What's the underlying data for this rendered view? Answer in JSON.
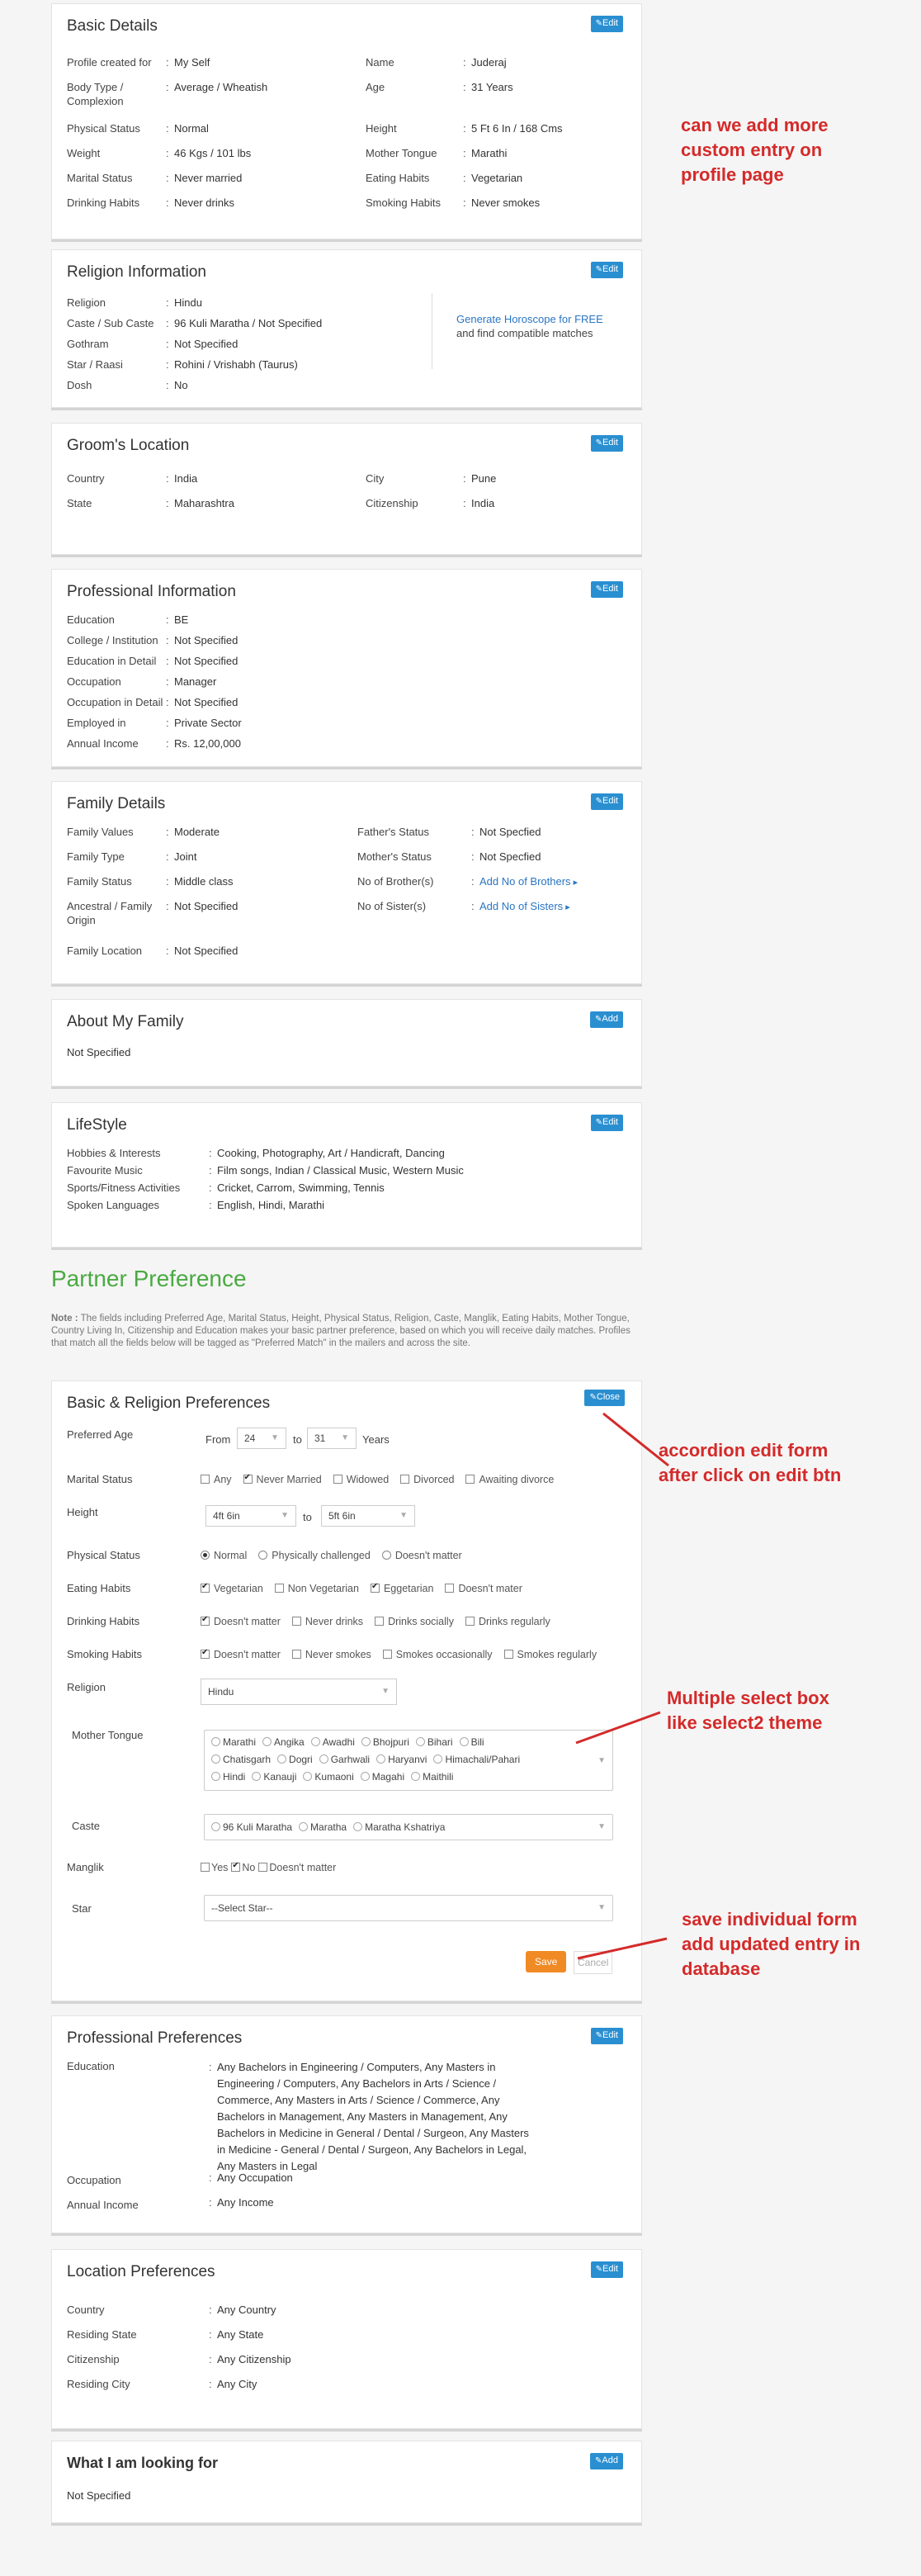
{
  "basic": {
    "title": "Basic Details",
    "edit": "Edit",
    "left": [
      [
        "Profile created for",
        "My Self"
      ],
      [
        "Body Type / Complexion",
        "Average / Wheatish"
      ],
      [
        "Physical Status",
        "Normal"
      ],
      [
        "Weight",
        "46 Kgs / 101 lbs"
      ],
      [
        "Marital Status",
        "Never married"
      ],
      [
        "Drinking Habits",
        "Never drinks"
      ]
    ],
    "right": [
      [
        "Name",
        "Juderaj"
      ],
      [
        "Age",
        "31 Years"
      ],
      [
        "Height",
        "5 Ft 6 In / 168 Cms"
      ],
      [
        "Mother Tongue",
        "Marathi"
      ],
      [
        "Eating Habits",
        "Vegetarian"
      ],
      [
        "Smoking Habits",
        "Never smokes"
      ]
    ]
  },
  "religion": {
    "title": "Religion Information",
    "edit": "Edit",
    "rows": [
      [
        "Religion",
        "Hindu"
      ],
      [
        "Caste / Sub Caste",
        "96 Kuli Maratha / Not Specified"
      ],
      [
        "Gothram",
        "Not Specified"
      ],
      [
        "Star / Raasi",
        "Rohini / Vrishabh (Taurus)"
      ],
      [
        "Dosh",
        "No"
      ]
    ],
    "horo_link": "Generate Horoscope for FREE",
    "horo_text": "and find compatible matches"
  },
  "location": {
    "title": "Groom's Location",
    "edit": "Edit",
    "rows": [
      [
        "Country",
        "India",
        "City",
        "Pune"
      ],
      [
        "State",
        "Maharashtra",
        "Citizenship",
        "India"
      ]
    ]
  },
  "professional": {
    "title": "Professional Information",
    "edit": "Edit",
    "rows": [
      [
        "Education",
        "BE"
      ],
      [
        "College / Institution",
        "Not Specified"
      ],
      [
        "Education in Detail",
        "Not Specified"
      ],
      [
        "Occupation",
        "Manager"
      ],
      [
        "Occupation in Detail",
        "Not Specified"
      ],
      [
        "Employed in",
        "Private Sector"
      ],
      [
        "Annual Income",
        "Rs. 12,00,000"
      ]
    ]
  },
  "family": {
    "title": "Family Details",
    "edit": "Edit",
    "left": [
      [
        "Family Values",
        "Moderate"
      ],
      [
        "Family Type",
        "Joint"
      ],
      [
        "Family Status",
        "Middle class"
      ],
      [
        "Ancestral / Family Origin",
        "Not Specified"
      ],
      [
        "Family Location",
        "Not Specified"
      ]
    ],
    "right": [
      [
        "Father's Status",
        "Not Specfied"
      ],
      [
        "Mother's Status",
        "Not Specfied"
      ],
      [
        "No of Brother(s)",
        "Add No of Brothers"
      ],
      [
        "No of Sister(s)",
        "Add No of Sisters"
      ]
    ]
  },
  "about_family": {
    "title": "About My Family",
    "add": "Add",
    "text": "Not Specified"
  },
  "lifestyle": {
    "title": "LifeStyle",
    "edit": "Edit",
    "rows": [
      [
        "Hobbies & Interests",
        "Cooking, Photography, Art / Handicraft, Dancing"
      ],
      [
        "Favourite Music",
        "Film songs, Indian / Classical Music, Western Music"
      ],
      [
        "Sports/Fitness Activities",
        "Cricket, Carrom, Swimming, Tennis"
      ],
      [
        "Spoken Languages",
        "English, Hindi, Marathi"
      ]
    ]
  },
  "partner": {
    "title": "Partner Preference",
    "note_bold": "Note :",
    "note": " The fields including Preferred Age, Marital Status, Height, Physical Status, Religion, Caste, Manglik, Eating Habits, Mother Tongue, Country Living In, Citizenship and Education makes your basic partner preference, based on which you will receive daily matches. Profiles that match all the fields below will be tagged as \"Preferred Match\" in the mailers and across the site."
  },
  "basic_pref": {
    "title": "Basic & Religion Preferences",
    "close": "Close",
    "age": {
      "label": "Preferred Age",
      "from": "From",
      "from_val": "24",
      "to": "to",
      "to_val": "31",
      "unit": "Years"
    },
    "marital": {
      "label": "Marital Status",
      "opts": [
        [
          "Any",
          false
        ],
        [
          "Never Married",
          true
        ],
        [
          "Widowed",
          false
        ],
        [
          "Divorced",
          false
        ],
        [
          "Awaiting divorce",
          false
        ]
      ]
    },
    "height": {
      "label": "Height",
      "from": "4ft 6in",
      "to": "to",
      "to_val": "5ft 6in"
    },
    "physical": {
      "label": "Physical Status",
      "opts": [
        [
          "Normal",
          true
        ],
        [
          "Physically challenged",
          false
        ],
        [
          "Doesn't matter",
          false
        ]
      ]
    },
    "eating": {
      "label": "Eating Habits",
      "opts": [
        [
          "Vegetarian",
          true
        ],
        [
          "Non Vegetarian",
          false
        ],
        [
          "Eggetarian",
          true
        ],
        [
          "Doesn't mater",
          false
        ]
      ]
    },
    "drinking": {
      "label": "Drinking Habits",
      "opts": [
        [
          "Doesn't matter",
          true
        ],
        [
          "Never drinks",
          false
        ],
        [
          "Drinks socially",
          false
        ],
        [
          "Drinks regularly",
          false
        ]
      ]
    },
    "smoking": {
      "label": "Smoking Habits",
      "opts": [
        [
          "Doesn't matter",
          true
        ],
        [
          "Never smokes",
          false
        ],
        [
          "Smokes occasionally",
          false
        ],
        [
          "Smokes regularly",
          false
        ]
      ]
    },
    "religion": {
      "label": "Religion",
      "value": "Hindu"
    },
    "mother_tongue": {
      "label": "Mother Tongue",
      "line1": [
        "Marathi",
        "Angika",
        "Awadhi",
        "Bhojpuri",
        "Bihari",
        "Bili"
      ],
      "line2": [
        "Chatisgarh",
        "Dogri",
        "Garhwali",
        "Haryanvi",
        "Himachali/Pahari"
      ],
      "line3": [
        "Hindi",
        "Kanauji",
        "Kumaoni",
        "Magahi",
        "Maithili"
      ]
    },
    "caste": {
      "label": "Caste",
      "values": [
        "96 Kuli Maratha",
        "Maratha",
        "Maratha Kshatriya"
      ]
    },
    "manglik": {
      "label": "Manglik",
      "opts": [
        [
          "Yes",
          false
        ],
        [
          "No",
          true
        ],
        [
          "Doesn't matter",
          false
        ]
      ]
    },
    "star": {
      "label": "Star",
      "value": "--Select Star--"
    },
    "save": "Save",
    "cancel": "Cancel"
  },
  "prof_pref": {
    "title": "Professional Preferences",
    "edit": "Edit",
    "education_label": "Education",
    "education": "Any Bachelors in Engineering / Computers, Any Masters in Engineering / Computers, Any Bachelors in Arts / Science / Commerce, Any Masters in Arts / Science / Commerce, Any Bachelors in Management, Any Masters in Management, Any Bachelors in Medicine in General / Dental / Surgeon, Any Masters in Medicine - General / Dental / Surgeon, Any Bachelors in Legal, Any Masters in Legal",
    "occupation_label": "Occupation",
    "occupation": "Any Occupation",
    "income_label": "Annual Income",
    "income": "Any Income"
  },
  "loc_pref": {
    "title": "Location Preferences",
    "edit": "Edit",
    "rows": [
      [
        "Country",
        "Any Country"
      ],
      [
        "Residing State",
        "Any State"
      ],
      [
        "Citizenship",
        "Any Citizenship"
      ],
      [
        "Residing City",
        "Any City"
      ]
    ]
  },
  "looking": {
    "title": "What I am looking for",
    "add": "Add",
    "text": "Not Specified"
  },
  "annotations": {
    "a1": [
      "can we add more",
      "custom entry on",
      "profile page"
    ],
    "a2": [
      "accordion edit form",
      "after click on edit btn"
    ],
    "a3": [
      "Multiple select box",
      "like select2 theme"
    ],
    "a4": [
      "save individual form",
      "add updated entry in",
      "database"
    ]
  },
  "colors": {
    "accent": "#2a8fd1",
    "green": "#4aaa42",
    "orange": "#f08a24",
    "annotation": "#d42a2a"
  }
}
